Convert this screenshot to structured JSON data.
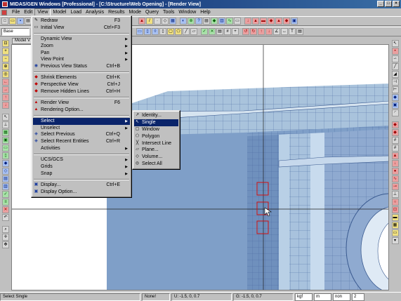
{
  "title": "MIDAS/GEN Windows [Professional] - [C:\\Structure\\Web Opening] - [Render View]",
  "window_controls": [
    "_",
    "□",
    "×"
  ],
  "menubar": [
    "File",
    "Edit",
    "View",
    "Model",
    "Load",
    "Analysis",
    "Results",
    "Mode",
    "Query",
    "Tools",
    "Window",
    "Help"
  ],
  "toolbar": {
    "combo_value": "Base"
  },
  "child_window_tab": "Model V",
  "view_menu": {
    "redraw": "Redraw",
    "redraw_sc": "F3",
    "initial_view": "Initial View",
    "initial_view_sc": "Ctrl+F3",
    "dynamic_view": "Dynamic View",
    "zoom": "Zoom",
    "pan": "Pan",
    "view_point": "View Point",
    "previous_view_status": "Previous View Status",
    "previous_view_status_sc": "Ctrl+B",
    "shrink_elements": "Shrink Elements",
    "shrink_elements_sc": "Ctrl+K",
    "perspective_view": "Perspective View",
    "perspective_view_sc": "Ctrl+J",
    "remove_hidden_lines": "Remove Hidden Lines",
    "remove_hidden_lines_sc": "Ctrl+H",
    "render_view": "Render View",
    "render_view_sc": "F6",
    "rendering_option": "Rendering Option...",
    "select": "Select",
    "unselect": "Unselect",
    "select_previous": "Select Previous",
    "select_previous_sc": "Ctrl+Q",
    "select_recent_entities": "Select Recent Entities",
    "select_recent_entities_sc": "Ctrl+R",
    "activities": "Activities",
    "ucs_gcs": "UCS/GCS",
    "grids": "Grids",
    "snap": "Snap",
    "display": "Display...",
    "display_sc": "Ctrl+E",
    "display_option": "Display Option..."
  },
  "select_submenu": [
    "Identity...",
    "Single",
    "Window",
    "Polygon",
    "Intersect Line",
    "Plane...",
    "Volume...",
    "Select All"
  ],
  "statusbar": {
    "message": "Select Single",
    "node": "None!",
    "u_coord": "U: -1.5, 0, 0.7",
    "g_coord": "G: -1.5, 0, 0.7",
    "unit_force": "kgf",
    "unit_length": "m",
    "extra": "non",
    "page": "2"
  }
}
